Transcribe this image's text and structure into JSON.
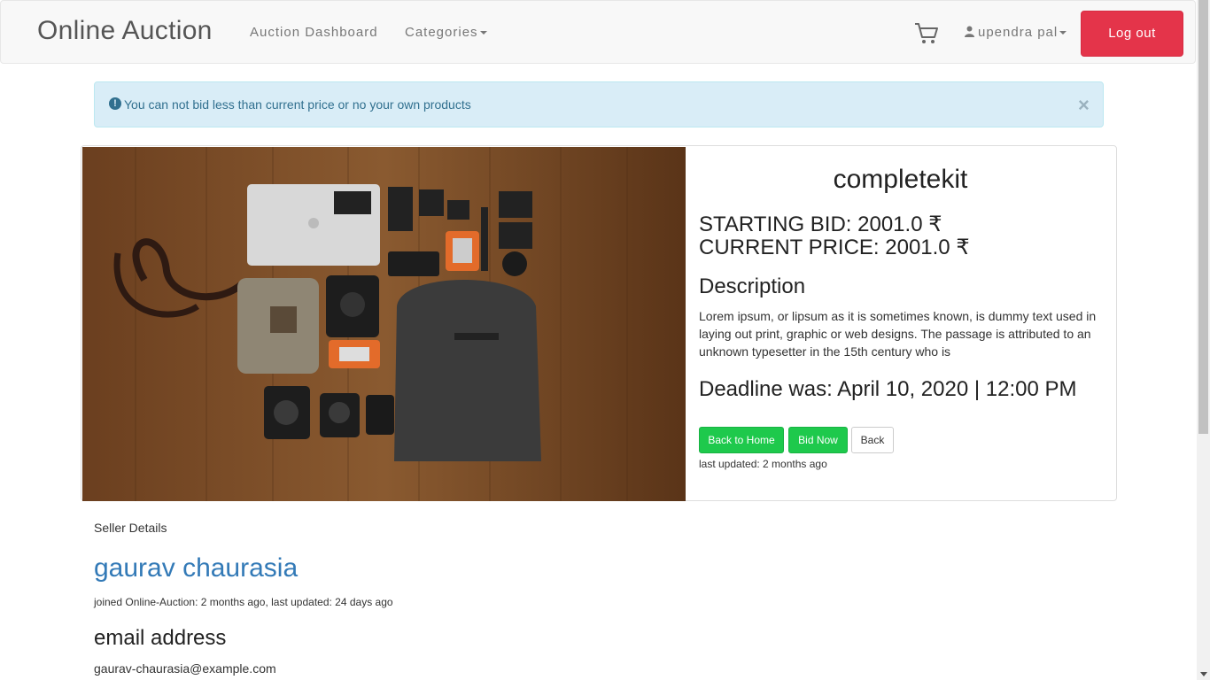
{
  "nav": {
    "brand": "Online Auction",
    "dashboard": "Auction Dashboard",
    "categories": "Categories",
    "user": "upendra pal",
    "logout": "Log out",
    "cart_icon": "shopping-cart-icon",
    "user_icon": "user-icon"
  },
  "alert": {
    "icon": "exclamation-circle-icon",
    "message": "You can not bid less than current price or no your own products",
    "close": "×"
  },
  "product": {
    "image_alt": "camera gear kit flat lay",
    "title": "completekit",
    "starting_bid": "STARTING BID: 2001.0 ₹",
    "current_price": "CURRENT PRICE: 2001.0 ₹",
    "description_heading": "Description",
    "description": "Lorem ipsum, or lipsum as it is sometimes known, is dummy text used in laying out print, graphic or web designs. The passage is attributed to an unknown typesetter in the 15th century who is",
    "deadline": "Deadline was: April 10, 2020 | 12:00 PM",
    "buttons": {
      "home": "Back to Home",
      "bid": "Bid Now",
      "back": "Back"
    },
    "last_updated": "last updated: 2 months ago"
  },
  "seller": {
    "label": "Seller Details",
    "name": "gaurav chaurasia",
    "meta": "joined Online-Auction: 2 months ago, last updated: 24 days ago",
    "email_heading": "email address",
    "email": "gaurav-chaurasia@example.com"
  },
  "colors": {
    "logout": "#e4344a",
    "bid_buttons": "#1ec94c",
    "alert_bg": "#d9edf7",
    "link": "#337ab7"
  }
}
